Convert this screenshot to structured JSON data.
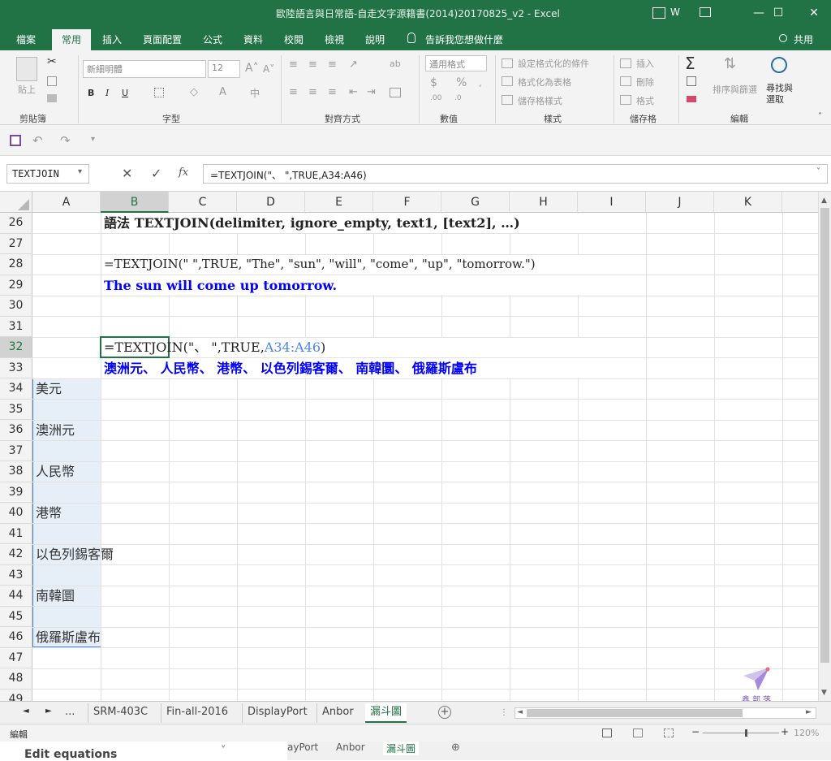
{
  "titlebar": {
    "title": "歐陸語言與日常語-自走文字源籍書(2014)20170825_v2 - Excel",
    "user": "W",
    "minimize": "—",
    "restore": "☐",
    "close": "✕"
  },
  "tabs": [
    "檔案",
    "常用",
    "插入",
    "頁面配置",
    "公式",
    "資料",
    "校閱",
    "檢視",
    "說明"
  ],
  "tellme": "告訴我您想做什麼",
  "share": "共用",
  "ribbon": {
    "clipboard": {
      "paste": "貼上",
      "label": "剪貼簿"
    },
    "font": {
      "name": "新細明體",
      "size": "12",
      "bold": "B",
      "italic": "I",
      "underline": "U",
      "label": "字型"
    },
    "alignment": {
      "wrap": "ab",
      "label": "對齊方式"
    },
    "number": {
      "format": "通用格式",
      "currency": "$",
      "percent": "%",
      "label": "數值"
    },
    "styles": {
      "conditional": "設定格式化的條件",
      "table": "格式化為表格",
      "cell": "儲存格樣式",
      "label": "樣式"
    },
    "cells": {
      "insert": "插入",
      "delete": "刪除",
      "format": "格式",
      "label": "儲存格"
    },
    "editing": {
      "sort": "排序與篩選",
      "find": "尋找與選取",
      "label": "編輯"
    }
  },
  "formula_bar": {
    "name_box": "TEXTJOIN",
    "cancel": "✕",
    "enter": "✓",
    "fx": "fx",
    "formula": "=TEXTJOIN(\"、 \",TRUE,A34:A46)"
  },
  "columns": [
    "A",
    "B",
    "C",
    "D",
    "E",
    "F",
    "G",
    "H",
    "I",
    "J",
    "K"
  ],
  "rows": [
    "26",
    "27",
    "28",
    "29",
    "30",
    "31",
    "32",
    "33",
    "34",
    "35",
    "36",
    "37",
    "38",
    "39",
    "40",
    "41",
    "42",
    "43",
    "44",
    "45",
    "46",
    "47",
    "48",
    "49"
  ],
  "cells": {
    "b26": "語法 TEXTJOIN(delimiter, ignore_empty, text1, [text2], …)",
    "b28": "=TEXTJOIN(\" \",TRUE, \"The\", \"sun\", \"will\", \"come\", \"up\", \"tomorrow.\")",
    "b29": "The sun will come up tomorrow.",
    "b32_prefix": "=TEXTJOIN(\"、 \",TRUE,",
    "b32_ref": "A34:A46",
    "b32_suffix": ")",
    "b33": "澳洲元、 人民幣、 港幣、 以色列錫客爾、 南韓圜、 俄羅斯盧布",
    "a34": "美元",
    "a36": "澳洲元",
    "a38": "人民幣",
    "a40": "港幣",
    "a42": "以色列錫客爾",
    "a44": "南韓圜",
    "a46": "俄羅斯盧布"
  },
  "sheets": [
    "...",
    "SRM-403C",
    "Fin-all-2016",
    "DisplayPort",
    "Anbor",
    "漏斗圖"
  ],
  "status": {
    "mode": "編輯",
    "zoom": "120%"
  },
  "bottom": {
    "edit_equations": "Edit equations",
    "ghost_tabs": [
      "ayPort",
      "Anbor",
      "漏斗圖"
    ]
  },
  "watermark": "鑫部落",
  "colors": {
    "excel_green": "#217346",
    "blue_text": "#0000ff",
    "ref_blue": "#4a86e8",
    "range_fill": "#e6eef8"
  }
}
